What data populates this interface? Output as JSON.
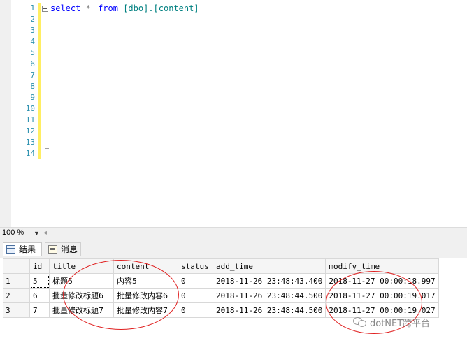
{
  "editor": {
    "line_numbers": [
      "1",
      "2",
      "3",
      "4",
      "5",
      "6",
      "7",
      "8",
      "9",
      "10",
      "11",
      "12",
      "13",
      "14"
    ],
    "query": {
      "kw_select": "select",
      "star": "*",
      "kw_from": "from",
      "table": "[dbo].[content]"
    }
  },
  "zoom": {
    "value": "100 %",
    "arrow": "◂"
  },
  "tabs": [
    {
      "label": "结果",
      "icon": "grid-icon"
    },
    {
      "label": "消息",
      "icon": "message-icon"
    }
  ],
  "results": {
    "columns": [
      "id",
      "title",
      "content",
      "status",
      "add_time",
      "modify_time"
    ],
    "rows": [
      {
        "num": "1",
        "id": "5",
        "title": "标题5",
        "content": "内容5",
        "status": "0",
        "add_time": "2018-11-26 23:48:43.400",
        "modify_time": "2018-11-27 00:00:18.997"
      },
      {
        "num": "2",
        "id": "6",
        "title": "批量修改标题6",
        "content": "批量修改内容6",
        "status": "0",
        "add_time": "2018-11-26 23:48:44.500",
        "modify_time": "2018-11-27 00:00:19.017"
      },
      {
        "num": "3",
        "id": "7",
        "title": "批量修改标题7",
        "content": "批量修改内容7",
        "status": "0",
        "add_time": "2018-11-26 23:48:44.500",
        "modify_time": "2018-11-27 00:00:19.027"
      }
    ]
  },
  "colors": {
    "keyword": "#0000ff",
    "identifier": "#008080",
    "line_number": "#2b91af",
    "annotation": "#e02020"
  },
  "watermark": {
    "text": "dotNET跨平台",
    "icon": "wechat-icon"
  }
}
